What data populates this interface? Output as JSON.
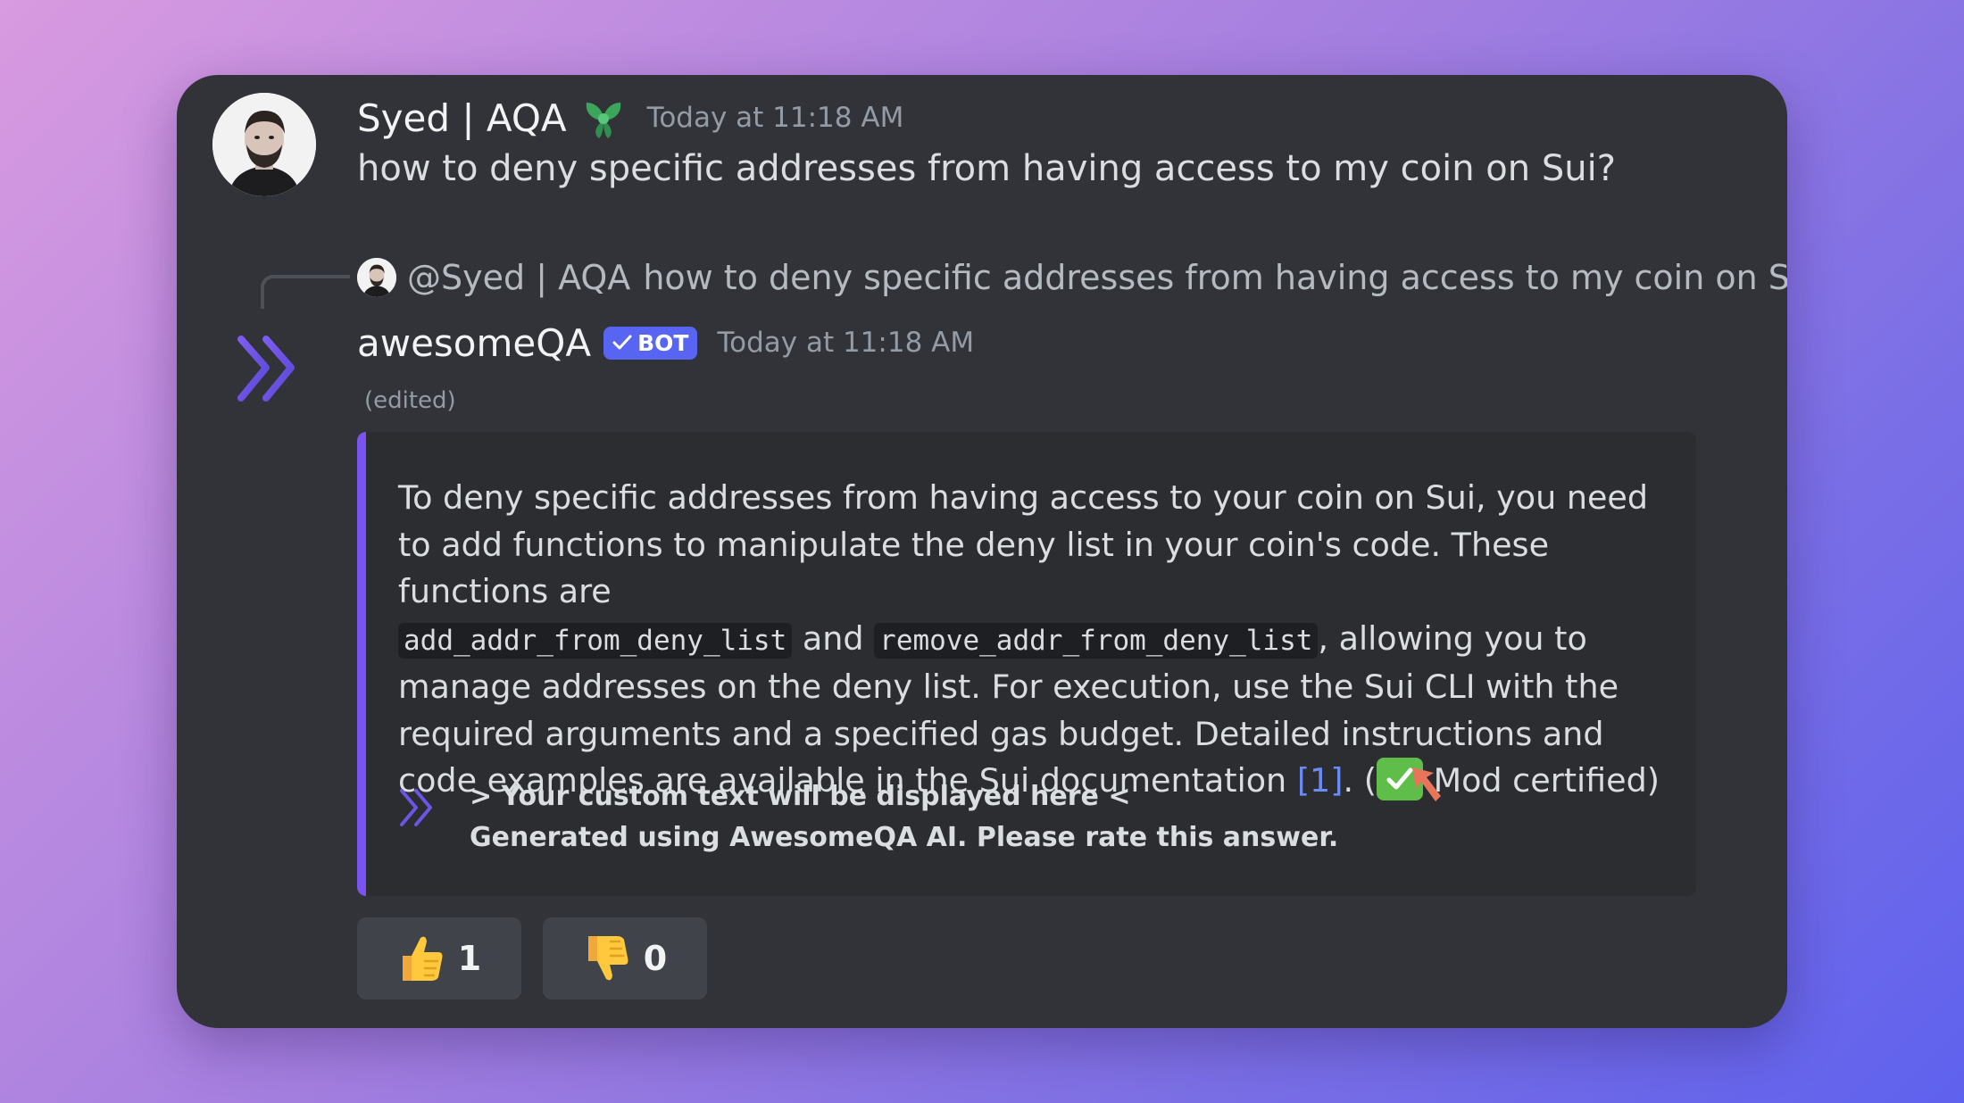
{
  "message": {
    "author": "Syed | AQA",
    "timestamp": "Today at 11:18 AM",
    "text": "how to deny specific addresses from having access to my coin on Sui?",
    "badge_icon": "leaf-badge-icon"
  },
  "reply": {
    "mention": "@Syed | AQA",
    "text": "how to deny specific addresses from having access to my coin on Sui?"
  },
  "bot": {
    "name": "awesomeQA",
    "tag": "BOT",
    "timestamp": "Today at 11:18 AM",
    "edited": "(edited)"
  },
  "embed": {
    "p1": "To deny specific addresses from having access to your coin on Sui, you need to add functions to manipulate the deny list in your coin's code. These functions are",
    "code1": "add_addr_from_deny_list",
    "and": "and",
    "code2": "remove_addr_from_deny_list",
    "p2": ", allowing you to manage addresses on the deny list. For execution, use the Sui CLI with the required arguments and a specified gas budget. Detailed instructions and code examples are available in the Sui documentation",
    "citation": "[1]",
    "p3": ". (",
    "certified": "Mod certified)",
    "footer_line1": "> Your custom text will be displayed here <",
    "footer_line2": "Generated using AwesomeQA AI. Please rate this answer.",
    "accent_color": "#7a54f0"
  },
  "reactions": [
    {
      "emoji": "thumbs-up-icon",
      "count": "1"
    },
    {
      "emoji": "thumbs-down-icon",
      "count": "0"
    }
  ]
}
